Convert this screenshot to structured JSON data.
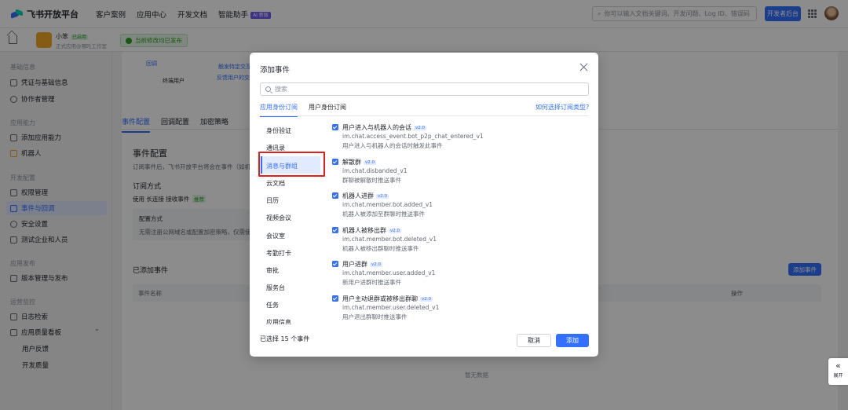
{
  "topbar": {
    "logo": "飞书开放平台",
    "nav": [
      "客户案例",
      "应用中心",
      "开发文档",
      "智能助手"
    ],
    "ai_badge": "AI 新版",
    "search_placeholder": "你可以输入文档关键词、开发问题、Log ID、错误码",
    "dev_console": "开发者后台"
  },
  "appbar": {
    "app_name": "小笨",
    "app_status": "已启用",
    "app_sub": "正式应用@哪吒工作室",
    "publish_tag": "当前修改均已发布"
  },
  "sidebar": {
    "sections": [
      "基础信息",
      "应用能力",
      "开发配置",
      "应用发布",
      "运营监控"
    ],
    "items": [
      "凭证与基础信息",
      "协作者管理",
      "添加应用能力",
      "机器人",
      "权限管理",
      "事件与回调",
      "安全设置",
      "测试企业和人员",
      "版本管理与发布",
      "日志检索",
      "应用质量看板"
    ],
    "subs": [
      "用户反馈",
      "开发质量"
    ]
  },
  "main": {
    "tabs": [
      "事件配置",
      "回调配置",
      "加密策略"
    ],
    "section_title": "事件配置",
    "section_desc": "订阅事件后，飞书开放平台将会在事件（如机",
    "sub_method": "订阅方式",
    "method_text": "使用 长连接 接收事件",
    "method_badge": "推荐",
    "config_label": "配置方式",
    "config_desc": "无需注册公网域名或配置加密策略，仅需使",
    "added_events": "已添加事件",
    "add_event_btn": "添加事件",
    "col_event_name": "事件名称",
    "col_action": "操作",
    "empty": "暂无数据",
    "flow_callback": "回调",
    "flow_user": "终端用户",
    "flow_note1": "触发特定交互",
    "flow_note2": "反馈用户的交互"
  },
  "modal": {
    "title": "添加事件",
    "search_placeholder": "搜索",
    "tabs": [
      "应用身份订阅",
      "用户身份订阅"
    ],
    "help_link": "如何选择订阅类型?",
    "categories": [
      "身份验证",
      "通讯录",
      "消息与群组",
      "云文档",
      "日历",
      "视频会议",
      "会议室",
      "考勤打卡",
      "审批",
      "服务台",
      "任务",
      "应用信息"
    ],
    "events": [
      {
        "name": "用户进入与机器人的会话",
        "ver": "v2.0",
        "code": "im.chat.access_event.bot_p2p_chat_entered_v1",
        "desc": "用户进入与机器人的会话时触发此事件"
      },
      {
        "name": "解散群",
        "ver": "v2.0",
        "code": "im.chat.disbanded_v1",
        "desc": "群聊被解散时推送事件"
      },
      {
        "name": "机器人进群",
        "ver": "v2.0",
        "code": "im.chat.member.bot.added_v1",
        "desc": "机器人被添加至群聊时推送事件"
      },
      {
        "name": "机器人被移出群",
        "ver": "v2.0",
        "code": "im.chat.member.bot.deleted_v1",
        "desc": "机器人被移出群聊时推送事件"
      },
      {
        "name": "用户进群",
        "ver": "v2.0",
        "code": "im.chat.member.user.added_v1",
        "desc": "新用户进群时推送事件"
      },
      {
        "name": "用户主动退群或被移出群聊",
        "ver": "v2.0",
        "code": "im.chat.member.user.deleted_v1",
        "desc": "用户退出群聊时推送事件"
      }
    ],
    "selected_count": "已选择 15 个事件",
    "cancel": "取消",
    "add": "添加"
  },
  "expand_label": "展开",
  "colors": {
    "accent": "#3370ff",
    "highlight_box": "#e02020"
  }
}
